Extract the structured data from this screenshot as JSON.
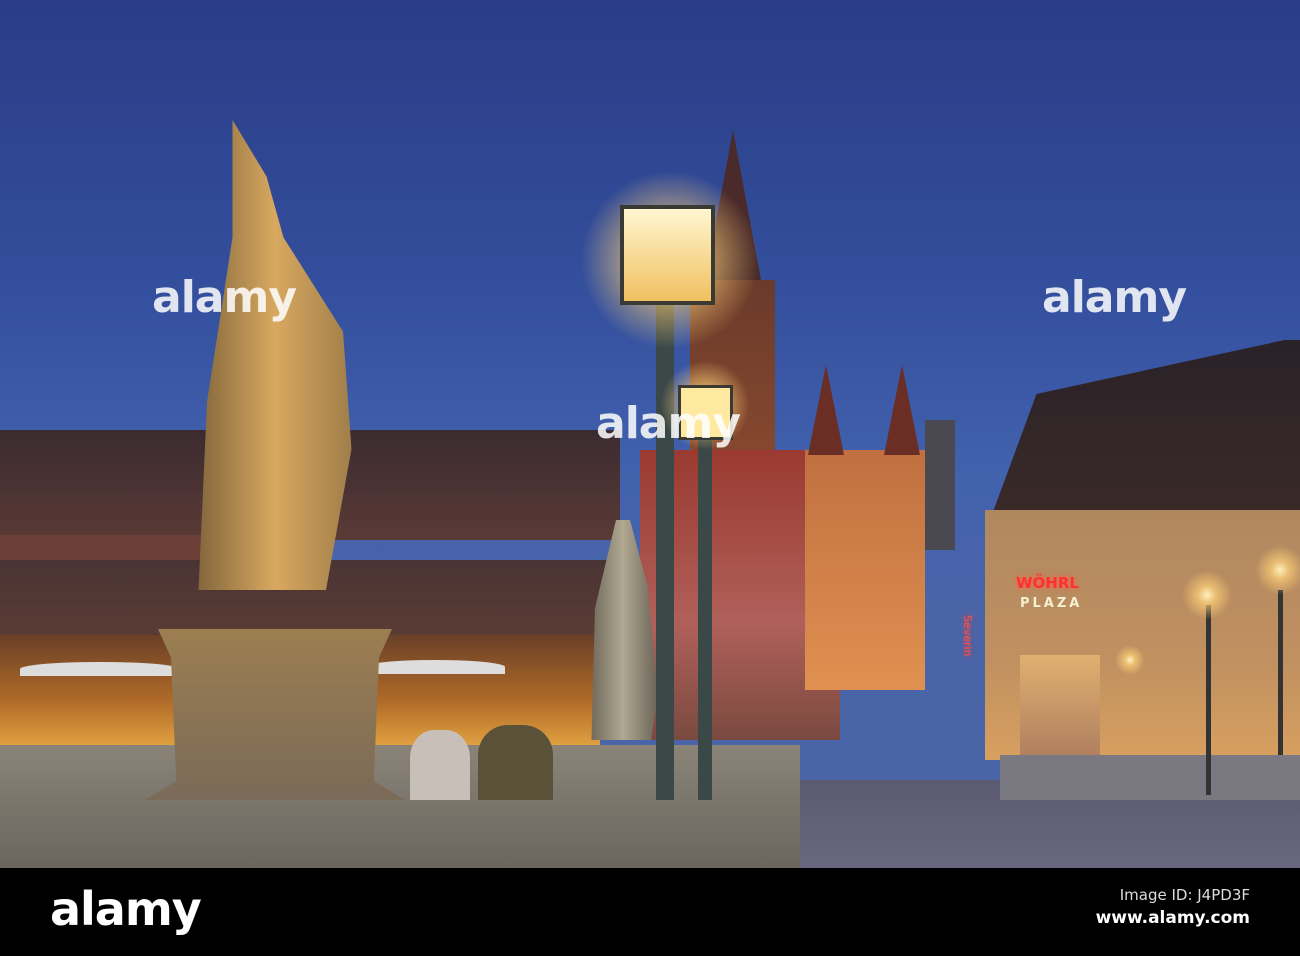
{
  "watermark": {
    "text": "alamy"
  },
  "sign": {
    "brand": "WÖHRL",
    "subtitle": "PLAZA",
    "neon": "Severin"
  },
  "footer": {
    "logo": "alamy",
    "image_id": "Image ID: J4PD3F",
    "url": "www.alamy.com"
  }
}
